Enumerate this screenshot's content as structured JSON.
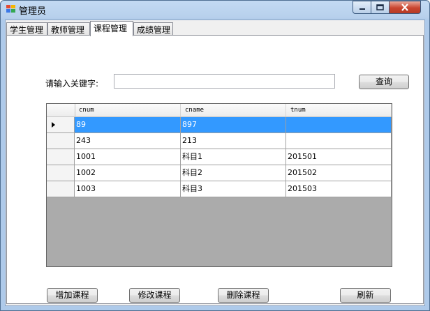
{
  "window": {
    "title": "管理员"
  },
  "tabs": [
    {
      "label": "学生管理",
      "active": false
    },
    {
      "label": "教师管理",
      "active": false
    },
    {
      "label": "课程管理",
      "active": true
    },
    {
      "label": "成绩管理",
      "active": false
    }
  ],
  "search": {
    "label": "请输入关键字:",
    "value": "",
    "button": "查询"
  },
  "grid": {
    "columns": [
      "cnum",
      "cname",
      "tnum"
    ],
    "rows": [
      [
        "89",
        "897",
        ""
      ],
      [
        "243",
        "213",
        ""
      ],
      [
        "1001",
        "科目1",
        "201501"
      ],
      [
        "1002",
        "科目2",
        "201502"
      ],
      [
        "1003",
        "科目3",
        "201503"
      ]
    ],
    "selected_row": 0,
    "selection_color": "#3399ff"
  },
  "actions": {
    "add": "增加课程",
    "edit": "修改课程",
    "delete": "删除课程",
    "refresh": "刷新"
  },
  "icons": {
    "app": "app-icon",
    "minimize": "minimize-icon",
    "maximize": "maximize-icon",
    "close": "close-icon",
    "row_indicator": "row-pointer-icon"
  }
}
